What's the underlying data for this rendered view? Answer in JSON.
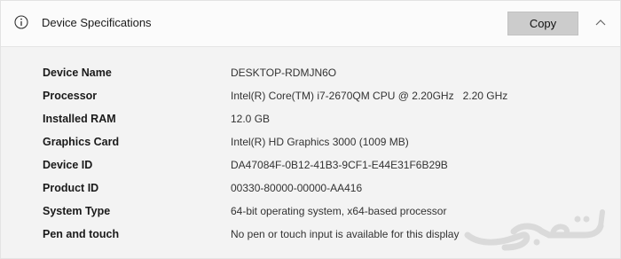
{
  "header": {
    "title": "Device Specifications",
    "copy_label": "Copy",
    "info_icon": "info-icon",
    "collapse_icon": "chevron-up-icon"
  },
  "specs": [
    {
      "label": "Device Name",
      "value": "DESKTOP-RDMJN6O"
    },
    {
      "label": "Processor",
      "value": "Intel(R) Core(TM) i7-2670QM CPU @ 2.20GHz   2.20 GHz"
    },
    {
      "label": "Installed RAM",
      "value": "12.0 GB"
    },
    {
      "label": "Graphics Card",
      "value": "Intel(R) HD Graphics 3000 (1009 MB)"
    },
    {
      "label": "Device ID",
      "value": "DA47084F-0B12-41B3-9CF1-E44E31F6B29B"
    },
    {
      "label": "Product ID",
      "value": "00330-80000-00000-AA416"
    },
    {
      "label": "System Type",
      "value": "64-bit operating system, x64-based processor"
    },
    {
      "label": "Pen and touch",
      "value": "No pen or touch input is available for this display"
    }
  ],
  "watermark": {
    "text": "حراج",
    "color": "#d9d9d9"
  }
}
